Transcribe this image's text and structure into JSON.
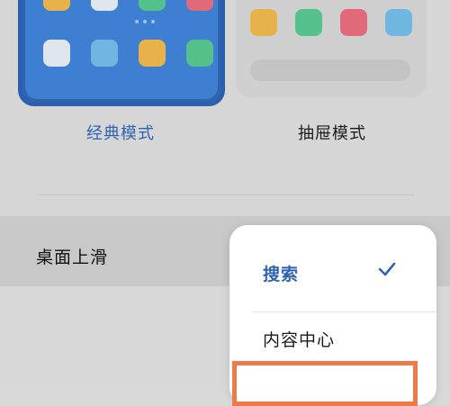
{
  "layout_modes": {
    "classic_label": "经典模式",
    "drawer_label": "抽屉模式",
    "classic_selected": true
  },
  "setting_row": {
    "label": "桌面上滑"
  },
  "popup_menu": {
    "options": [
      {
        "label": "搜索",
        "selected": true
      },
      {
        "label": "内容中心",
        "selected": false
      }
    ]
  },
  "icons": {
    "check": "check-icon"
  },
  "colors": {
    "accent": "#2f63b1",
    "highlight": "#ee7a4a",
    "tile_yellow": "#e8b24a",
    "tile_green": "#54c08a",
    "tile_red": "#e06a7a",
    "tile_blue": "#6fb7e0",
    "tile_white": "#dfe6ee"
  }
}
